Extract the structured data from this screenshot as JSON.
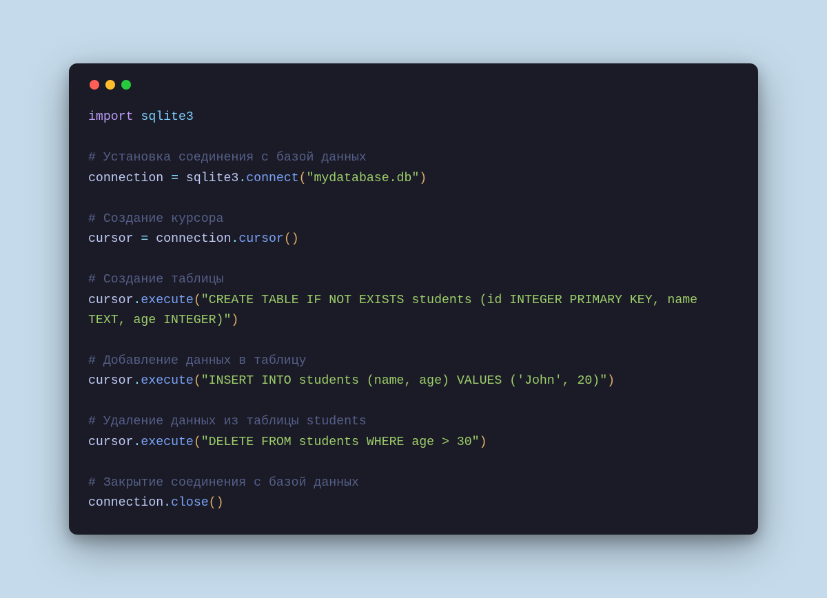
{
  "code": {
    "l01": {
      "kw_import": "import",
      "module": "sqlite3"
    },
    "l02": {
      "comment": "# Установка соединения с базой данных"
    },
    "l03": {
      "ident": "connection",
      "eq": " = ",
      "obj": "sqlite3",
      "dot": ".",
      "fn": "connect",
      "lp": "(",
      "str": "\"mydatabase.db\"",
      "rp": ")"
    },
    "l04": {
      "comment": "# Создание курсора"
    },
    "l05": {
      "ident": "cursor",
      "eq": " = ",
      "obj": "connection",
      "dot": ".",
      "fn": "cursor",
      "lp": "(",
      "rp": ")"
    },
    "l06": {
      "comment": "# Создание таблицы"
    },
    "l07": {
      "obj": "cursor",
      "dot": ".",
      "fn": "execute",
      "lp": "(",
      "str": "\"CREATE TABLE IF NOT EXISTS students (id INTEGER PRIMARY KEY, name TEXT, age INTEGER)\"",
      "rp": ")"
    },
    "l08": {
      "comment": "# Добавление данных в таблицу"
    },
    "l09": {
      "obj": "cursor",
      "dot": ".",
      "fn": "execute",
      "lp": "(",
      "str": "\"INSERT INTO students (name, age) VALUES ('John', 20)\"",
      "rp": ")"
    },
    "l10": {
      "comment": "# Удаление данных из таблицы students"
    },
    "l11": {
      "obj": "cursor",
      "dot": ".",
      "fn": "execute",
      "lp": "(",
      "str": "\"DELETE FROM students WHERE age > 30\"",
      "rp": ")"
    },
    "l12": {
      "comment": "# Закрытие соединения с базой данных"
    },
    "l13": {
      "obj": "connection",
      "dot": ".",
      "fn": "close",
      "lp": "(",
      "rp": ")"
    }
  },
  "colors": {
    "window_bg": "#1a1b26",
    "page_bg": "#c5dbeb",
    "dot_red": "#ff5f56",
    "dot_yellow": "#ffbd2e",
    "dot_green": "#27c93f",
    "keyword": "#bb9af7",
    "module": "#7dcfff",
    "comment": "#565f89",
    "ident": "#c0caf5",
    "punct": "#89ddff",
    "paren": "#e0af68",
    "func": "#7aa2f7",
    "string": "#9ece6a"
  }
}
